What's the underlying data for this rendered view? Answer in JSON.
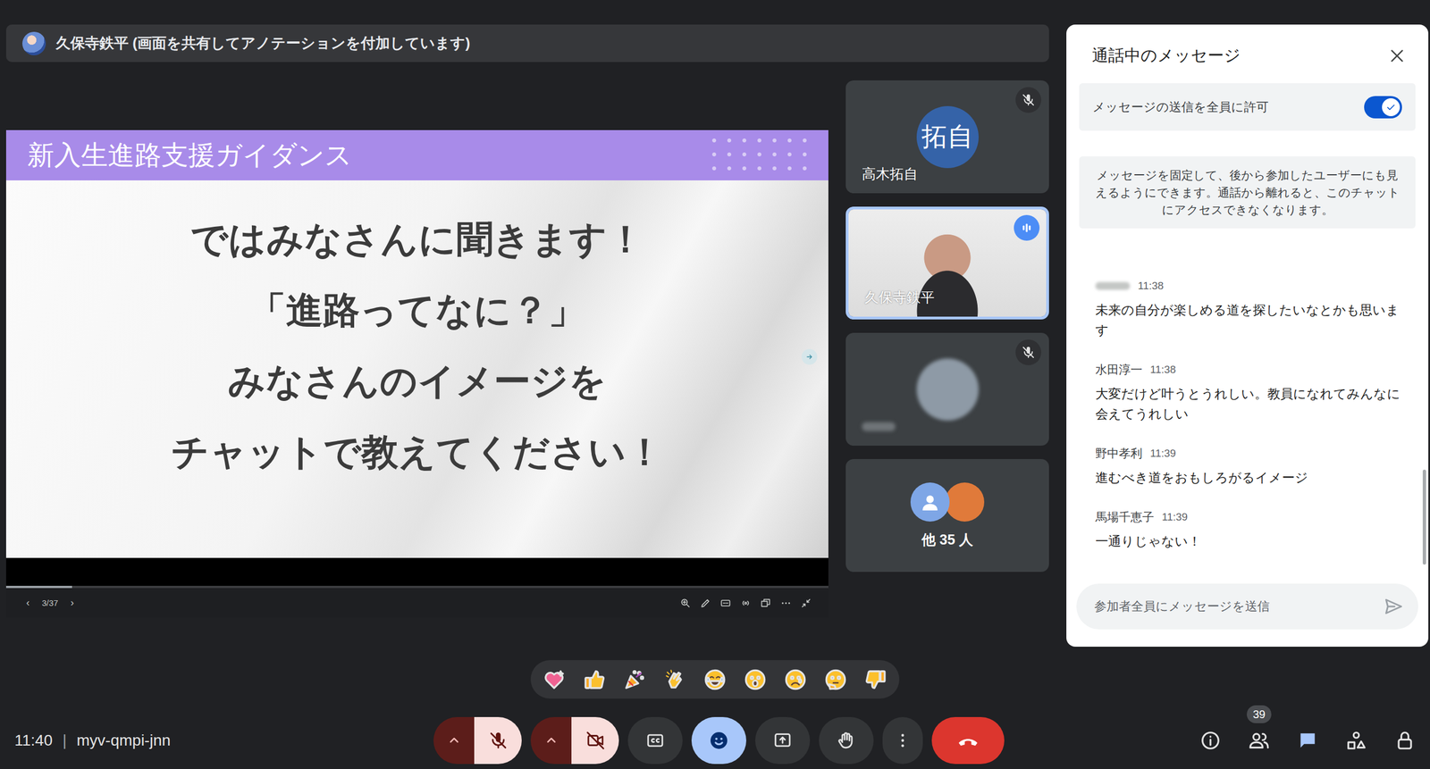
{
  "meeting": {
    "time": "11:40",
    "separator": "|",
    "code": "myv-qmpi-jnn"
  },
  "presenter_banner": {
    "text": "久保寺鉄平 (画面を共有してアノテーションを付加しています)"
  },
  "slide": {
    "header": "新入生進路支援ガイダンス",
    "lines": [
      "ではみなさんに聞きます！",
      "「進路ってなに？」",
      "みなさんのイメージを",
      "チャットで教えてください！"
    ]
  },
  "slide_toolbar": {
    "prev": "‹",
    "page": "3/37",
    "next": "›",
    "level": 0.08
  },
  "tiles": [
    {
      "kind": "avatar",
      "name": "高木拓自",
      "initials": "拓自",
      "muted": true
    },
    {
      "kind": "video",
      "name": "久保寺鉄平",
      "speaking": true
    },
    {
      "kind": "blurred",
      "muted": true
    },
    {
      "kind": "others",
      "label": "他 35 人"
    }
  ],
  "chat": {
    "title": "通話中のメッセージ",
    "permission": {
      "label": "メッセージの送信を全員に許可",
      "on": true
    },
    "info": "メッセージを固定して、後から参加したユーザーにも見えるようにできます。通話から離れると、このチャットにアクセスできなくなります。",
    "messages": [
      {
        "time": "11:38",
        "text": "未来の自分が楽しめる道を探したいなとかも思います"
      },
      {
        "sender": "水田淳一",
        "time": "11:38",
        "text": "大変だけど叶うとうれしい。教員になれてみんなに会えてうれしい"
      },
      {
        "sender": "野中孝利",
        "time": "11:39",
        "text": "進むべき道をおもしろがるイメージ"
      },
      {
        "sender": "馬場千恵子",
        "time": "11:39",
        "text": "一通りじゃない！"
      }
    ],
    "input": {
      "placeholder": "参加者全員にメッセージを送信"
    }
  },
  "controls": {
    "mic": {
      "muted": true
    },
    "camera": {
      "off": true
    },
    "reactions": {
      "selected": true
    },
    "people": {
      "count": "39"
    },
    "chat": {
      "selected": true
    }
  }
}
